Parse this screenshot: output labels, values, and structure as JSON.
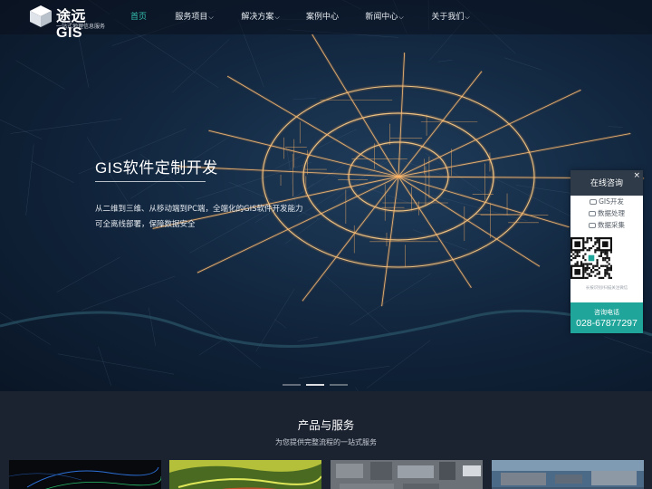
{
  "header": {
    "logo_title": "途远GIS",
    "logo_subtitle": "一站式地理信息服务",
    "menu": [
      {
        "label": "首页",
        "active": true,
        "dropdown": false
      },
      {
        "label": "服务项目",
        "active": false,
        "dropdown": true
      },
      {
        "label": "解决方案",
        "active": false,
        "dropdown": true
      },
      {
        "label": "案例中心",
        "active": false,
        "dropdown": false
      },
      {
        "label": "新闻中心",
        "active": false,
        "dropdown": true
      },
      {
        "label": "关于我们",
        "active": false,
        "dropdown": true
      }
    ]
  },
  "hero": {
    "title": "GIS软件定制开发",
    "line1": "从二维到三维、从移动端到PC端，全端化的GIS软件开发能力",
    "line2": "可全离线部署，保障数据安全",
    "slides": 3,
    "active_slide": 1
  },
  "consult": {
    "title": "在线咨询",
    "close": "×",
    "links": [
      "GIS开发",
      "数据处理",
      "数据采集"
    ],
    "qr_note": "长按识别/扫描关注微信",
    "phone_label": "咨询电话",
    "phone": "028-67877297"
  },
  "products": {
    "title": "产品与服务",
    "subtitle": "为您提供完整流程的一站式服务"
  },
  "colors": {
    "accent": "#35c0b0",
    "phone_bg": "#1fa59a",
    "road_glow": "#ff9a3c"
  }
}
